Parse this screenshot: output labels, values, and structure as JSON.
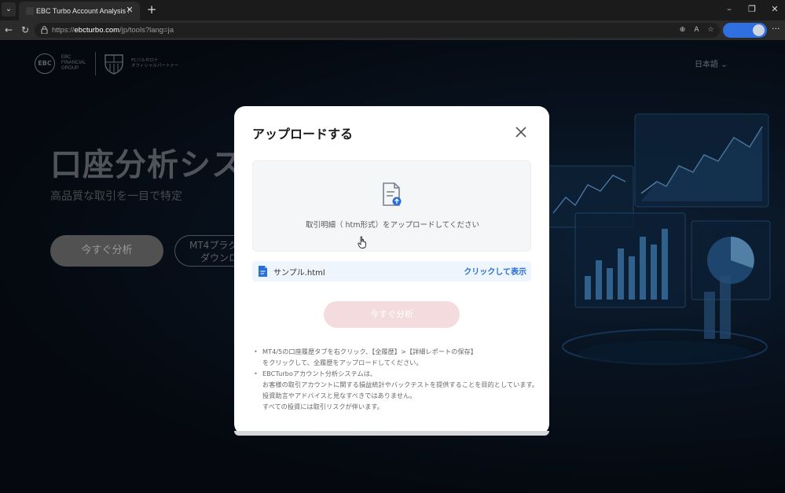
{
  "browser": {
    "tab_title": "EBC Turbo Account Analysis Syste",
    "url_prefix": "https://",
    "url_domain": "ebcturbo.com",
    "url_path": "/jp/tools?lang=ja"
  },
  "site": {
    "brand_ebc": "EBC FINANCIAL GROUP",
    "brand_ebc_line1": "EBC",
    "brand_ebc_line2": "FINANCIAL",
    "brand_ebc_line3": "GROUP",
    "partner_line1": "FCバルセロナ",
    "partner_line2": "オフィシャルパートナー",
    "language": "日本語",
    "hero_title": "口座分析シス",
    "hero_subtitle": "高品質な取引を一目で特定",
    "hero_primary_button": "今すぐ分析",
    "hero_secondary_line1": "MT4プラグ",
    "hero_secondary_line2": "ダウンロ"
  },
  "modal": {
    "title": "アップロードする",
    "drop_hint": "取引明細（ htm形式）をアップロードしてください",
    "file_name": "サンプル.html",
    "file_action": "クリックして表示",
    "analyze_button": "今すぐ分析",
    "notes": [
      [
        "MT4/5の口座履歴タブを右クリック、【全履歴】>【詳細レポートの保存】",
        "をクリックして、全履歴をアップロードしてください。"
      ],
      [
        "EBCTurboアカウント分析システムは、",
        "お客様の取引アカウントに関する損益統計やバックテストを提供することを目的としています。",
        "投資助言やアドバイスと見なすべきではありません。",
        "すべての投資には取引リスクが伴います。"
      ]
    ]
  },
  "colors": {
    "accent_blue": "#2a6fd6",
    "button_disabled_pink": "#f4dcde",
    "profile_blue": "#2f6fe0"
  }
}
